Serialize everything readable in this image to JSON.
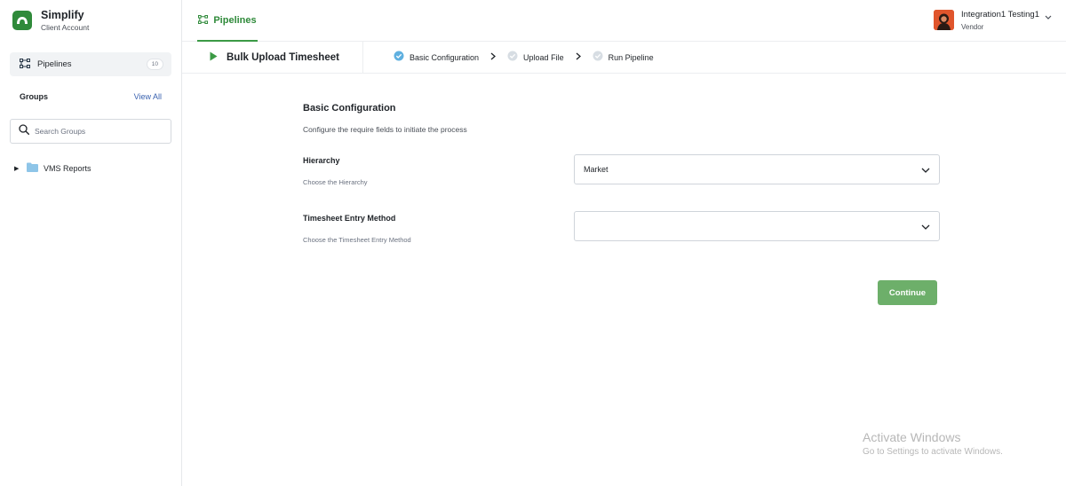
{
  "brand": {
    "name": "Simplify",
    "subtitle": "Client Account"
  },
  "sidebar": {
    "pipelines": {
      "label": "Pipelines",
      "count": "10"
    },
    "groups": {
      "title": "Groups",
      "view_all": "View All"
    },
    "search": {
      "placeholder": "Search Groups"
    },
    "tree": [
      {
        "label": "VMS Reports"
      }
    ]
  },
  "topbar": {
    "tab": {
      "label": "Pipelines"
    },
    "user": {
      "name": "Integration1 Testing1",
      "role": "Vendor"
    }
  },
  "stepbar": {
    "pipeline_title": "Bulk Upload Timesheet",
    "steps": [
      {
        "label": "Basic Configuration",
        "status": "complete"
      },
      {
        "label": "Upload File",
        "status": "pending"
      },
      {
        "label": "Run Pipeline",
        "status": "pending"
      }
    ]
  },
  "form": {
    "title": "Basic Configuration",
    "subtitle": "Configure the require fields to initiate the process",
    "fields": [
      {
        "label": "Hierarchy",
        "help": "Choose the Hierarchy",
        "value": "Market"
      },
      {
        "label": "Timesheet Entry Method",
        "help": "Choose the Timesheet Entry Method",
        "value": ""
      }
    ],
    "continue_label": "Continue"
  },
  "watermark": {
    "title": "Activate Windows",
    "subtitle": "Go to Settings to activate Windows."
  },
  "colors": {
    "brand_green": "#2f8a3a",
    "button_green": "#6daf6a",
    "step_check": "#5fb0e0",
    "step_pending": "#d7dde3"
  }
}
